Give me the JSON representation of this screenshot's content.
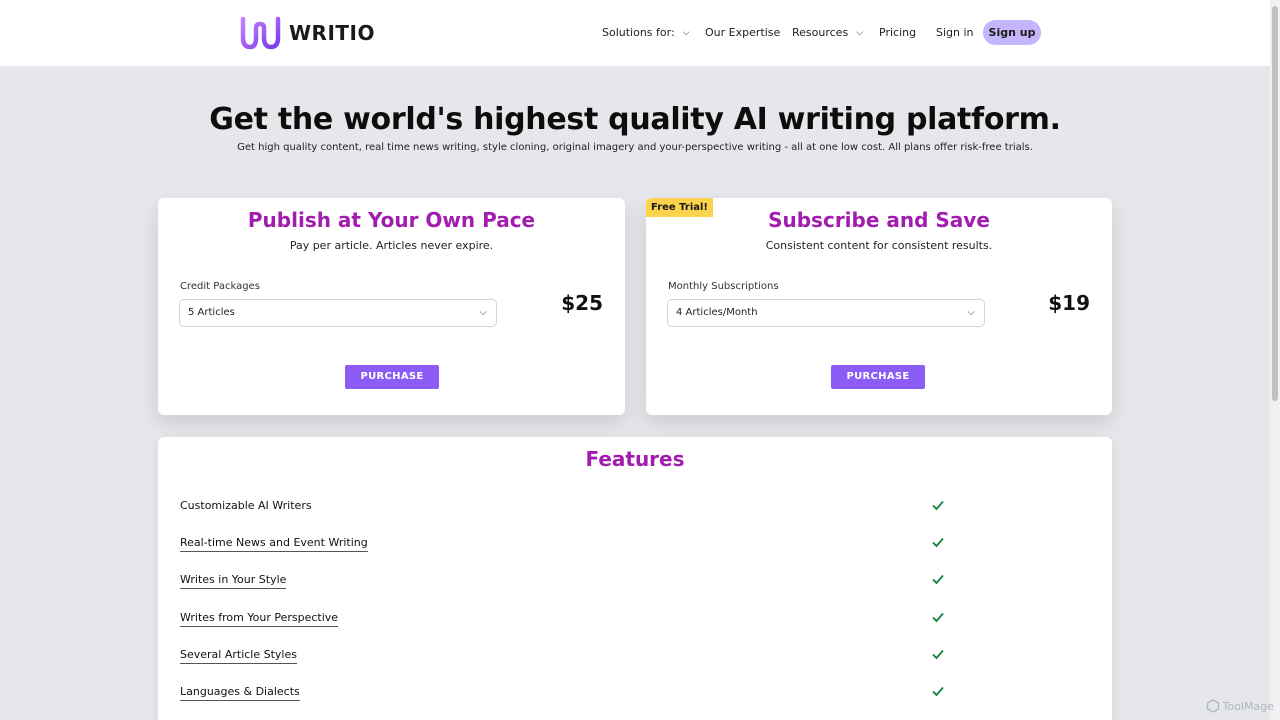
{
  "brand": {
    "name": "WRITIO",
    "accent": "#8b5cf6",
    "title_color": "#a21caf"
  },
  "nav": {
    "solutions": "Solutions for:",
    "expertise": "Our Expertise",
    "resources": "Resources",
    "pricing": "Pricing",
    "signin": "Sign in",
    "signup": "Sign up"
  },
  "hero": {
    "title": "Get the world's highest quality AI writing platform.",
    "subtitle": "Get high quality content, real time news writing, style cloning, original imagery and your-perspective writing - all at one low cost. All plans offer risk-free trials."
  },
  "plans": [
    {
      "title": "Publish at Your Own Pace",
      "subtitle": "Pay per article. Articles never expire.",
      "select_label": "Credit Packages",
      "select_value": "5 Articles",
      "price": "$25",
      "button": "PURCHASE"
    },
    {
      "badge": "Free Trial!",
      "title": "Subscribe and Save",
      "subtitle": "Consistent content for consistent results.",
      "select_label": "Monthly Subscriptions",
      "select_value": "4 Articles/Month",
      "price": "$19",
      "button": "PURCHASE"
    }
  ],
  "features": {
    "title": "Features",
    "items": [
      {
        "label": "Customizable AI Writers",
        "included": true
      },
      {
        "label": "Real-time News and Event Writing",
        "included": true
      },
      {
        "label": "Writes in Your Style",
        "included": true
      },
      {
        "label": "Writes from Your Perspective",
        "included": true
      },
      {
        "label": "Several Article Styles",
        "included": true
      },
      {
        "label": "Languages & Dialects",
        "included": true
      }
    ]
  },
  "watermark": "ToolMage"
}
